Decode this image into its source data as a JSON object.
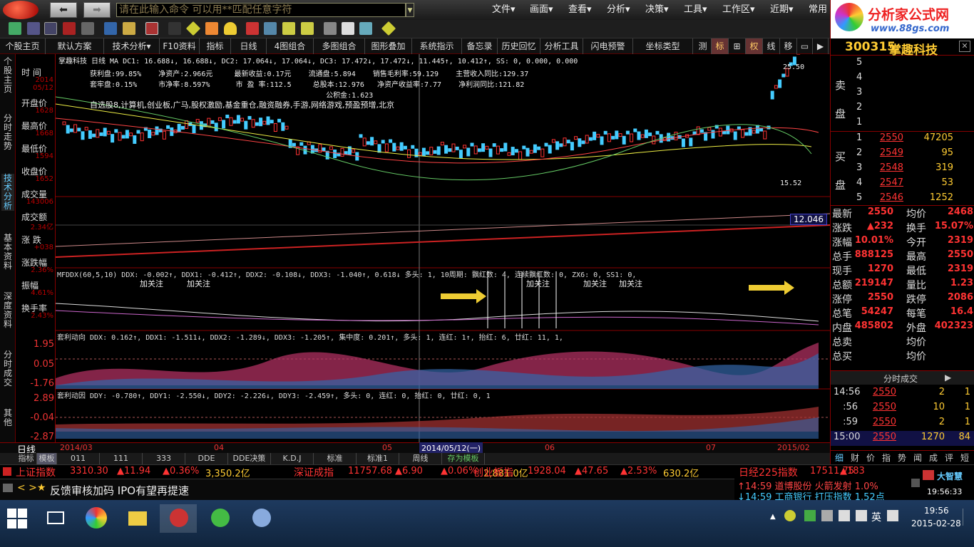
{
  "topbar": {
    "command_placeholder": "请在此输入命令   可以用**匹配任意字符",
    "menus": [
      "文件▾",
      "画面▾",
      "查看▾",
      "分析▾",
      "决策▾",
      "工具▾",
      "工作区▾",
      "近期▾",
      "常用"
    ]
  },
  "brand": {
    "title": "分析家公式网",
    "url": "www.88gs.com"
  },
  "tabs": [
    "个股主页",
    "默认方案",
    "技术分析▾",
    "F10资料",
    "指标",
    "日线",
    "4图组合",
    "多图组合",
    "图形叠加",
    "系统指示",
    "备忘录",
    "历史回忆",
    "分析工具",
    "闪电预警",
    "坐标类型",
    "测",
    "标",
    "⊞",
    "权",
    "线",
    "移"
  ],
  "left_vtabs": [
    "个股主页",
    "分时走势",
    "技术分析",
    "基本资料",
    "深度资料",
    "分时成交",
    "其他"
  ],
  "left_info": [
    {
      "label": "时 间",
      "value": "2014\n05/12"
    },
    {
      "label": "开盘价",
      "value": "1628"
    },
    {
      "label": "最高价",
      "value": "1668"
    },
    {
      "label": "最低价",
      "value": "1594"
    },
    {
      "label": "收盘价",
      "value": "1652"
    },
    {
      "label": "成交量",
      "value": "143006"
    },
    {
      "label": "成交额",
      "value": "2.34亿"
    },
    {
      "label": "涨 跌",
      "value": "+038"
    },
    {
      "label": "涨跌幅",
      "value": "2.36%"
    },
    {
      "label": "振幅",
      "value": "4.61%"
    },
    {
      "label": "换手率",
      "value": "2.43%"
    }
  ],
  "chart": {
    "header": "掌趣科技 日线  MA DC1: 16.688↓, 16.688↓, DC2: 17.064↓, 17.064↓, DC3: 17.472↓, 17.472↓, 11.445↑, 10.412↑, SS: 0, 0.000, 0.000",
    "fund_lines": [
      "获利盘:99.85%    净资产:2.966元     最新收益:0.17元    流通盘:5.894    销售毛利率:59.129    主营收入同比:129.37",
      "套牢盘:0.15%     市净率:8.597%      市 盈 率:112.5     总股本:12.976   净资产收益率:7.77    净利润同比:121.82",
      "                                                       公积金:1.623"
    ],
    "concepts": "自选股8,计算机,创业板,广马,股权激励,基金重仓,融资融券,手游,网络游戏,预盈预增,北京",
    "price_high": "25.50",
    "price_low": "15.52",
    "vol_tag": "12.046",
    "panel2": "MFDDX(60,5,10)  DDX: -0.002↑, DDX1: -0.412↑, DDX2: -0.108↓, DDX3: -1.040↑, 0.618↓  多头: 1, 10周期:  飘红数: 4, 连续飘红数: 0, ZX6: 0, SS1: 0,",
    "panel2_marks": [
      "加关注",
      "加关注",
      "加关注",
      "加关注",
      "加关注"
    ],
    "panel3": "套利动向  DDX: 0.162↑, DDX1: -1.511↓, DDX2: -1.289↓, DDX3: -1.205↑, 集中度: 0.201↑, 多头: 1, 连红: 1↑, 抬红: 6, 廿红: 11, 1,",
    "panel3_axis": [
      "1.95",
      "0.05",
      "-1.76"
    ],
    "panel4": "套利动因  DDY: -0.780↑, DDY1: -2.550↓, DDY2: -2.226↓, DDY3: -2.459↑, 多头: 0, 连红: 0, 抬红: 0, 廿红: 0, 1",
    "panel4_axis": [
      "2.89",
      "-0.04",
      "-2.87"
    ]
  },
  "datebar": {
    "label": "日线",
    "dates": [
      "2014/03",
      "04",
      "05",
      "2014/05/12(一)",
      "06",
      "07",
      "2015/02"
    ]
  },
  "bottom_tabs": [
    "指标",
    "模板",
    "011",
    "111",
    "333",
    "DDE",
    "DDE决策",
    "K.D.J",
    "标准",
    "标准1",
    "周线",
    "存为模板"
  ],
  "stock": {
    "code": "300315",
    "name": "掌趣科技"
  },
  "orderbook": {
    "sell_label": "卖盘",
    "buy_label": "买盘",
    "sell": [
      "5",
      "4",
      "3",
      "2",
      "1"
    ],
    "buy": [
      {
        "lvl": "1",
        "price": "2550",
        "vol": "47205"
      },
      {
        "lvl": "2",
        "price": "2549",
        "vol": "95"
      },
      {
        "lvl": "3",
        "price": "2548",
        "vol": "319"
      },
      {
        "lvl": "4",
        "price": "2547",
        "vol": "53"
      },
      {
        "lvl": "5",
        "price": "2546",
        "vol": "1252"
      }
    ]
  },
  "quote": [
    {
      "l1": "最新",
      "v1": "2550",
      "l2": "均价",
      "v2": "2468"
    },
    {
      "l1": "涨跌",
      "v1": "▲232",
      "l2": "换手",
      "v2": "15.07%"
    },
    {
      "l1": "涨幅",
      "v1": "10.01%",
      "l2": "今开",
      "v2": "2319"
    },
    {
      "l1": "总手",
      "v1": "888125",
      "l2": "最高",
      "v2": "2550"
    },
    {
      "l1": "现手",
      "v1": "1270",
      "l2": "最低",
      "v2": "2319"
    },
    {
      "l1": "总额",
      "v1": "219147",
      "l2": "量比",
      "v2": "1.23"
    },
    {
      "l1": "涨停",
      "v1": "2550",
      "l2": "跌停",
      "v2": "2086"
    },
    {
      "l1": "总笔",
      "v1": "54247",
      "l2": "每笔",
      "v2": "16.4"
    },
    {
      "l1": "内盘",
      "v1": "485802",
      "l2": "外盘",
      "v2": "402323"
    },
    {
      "l1": "总卖",
      "v1": "",
      "l2": "均价",
      "v2": ""
    },
    {
      "l1": "总买",
      "v1": "",
      "l2": "均价",
      "v2": ""
    }
  ],
  "ticks_title": "分时成交",
  "ticks": [
    {
      "t": "14:56",
      "p": "2550",
      "v": "2",
      "n": "1"
    },
    {
      "t": ":56",
      "p": "2550",
      "v": "10",
      "n": "1"
    },
    {
      "t": ":59",
      "p": "2550",
      "v": "2",
      "n": "1"
    },
    {
      "t": "15:00",
      "p": "2550",
      "v": "1270",
      "n": "84"
    }
  ],
  "right_tabs": [
    "细",
    "财",
    "价",
    "指",
    "势",
    "闻",
    "成",
    "评",
    "短"
  ],
  "ticker": [
    {
      "name": "上证指数",
      "price": "3310.30",
      "chg": "▲11.94",
      "pct": "▲0.36%",
      "amt": "3,350.2亿"
    },
    {
      "name": "深证成指",
      "price": "11757.68",
      "chg": "▲6.90",
      "pct": "▲0.06%",
      "amt": "2,881.0亿"
    },
    {
      "name": "创业板指",
      "price": "1928.04",
      "chg": "▲47.65",
      "pct": "▲2.53%",
      "amt": "630.2亿"
    },
    {
      "name": "日经225指数",
      "price": "17511.75",
      "chg": "▲183",
      "pct": "",
      "amt": ""
    }
  ],
  "news": "反馈审核加码 IPO有望再提速",
  "alerts": [
    "↑14:59 道博股份 火箭发射 1.0%",
    "↓14:59 工商银行 打压指数 1.52点"
  ],
  "clock": {
    "brand": "大智慧",
    "time": "19:56:33"
  },
  "taskbar": {
    "ime": "英",
    "time": "19:56",
    "date": "2015-02-28"
  }
}
